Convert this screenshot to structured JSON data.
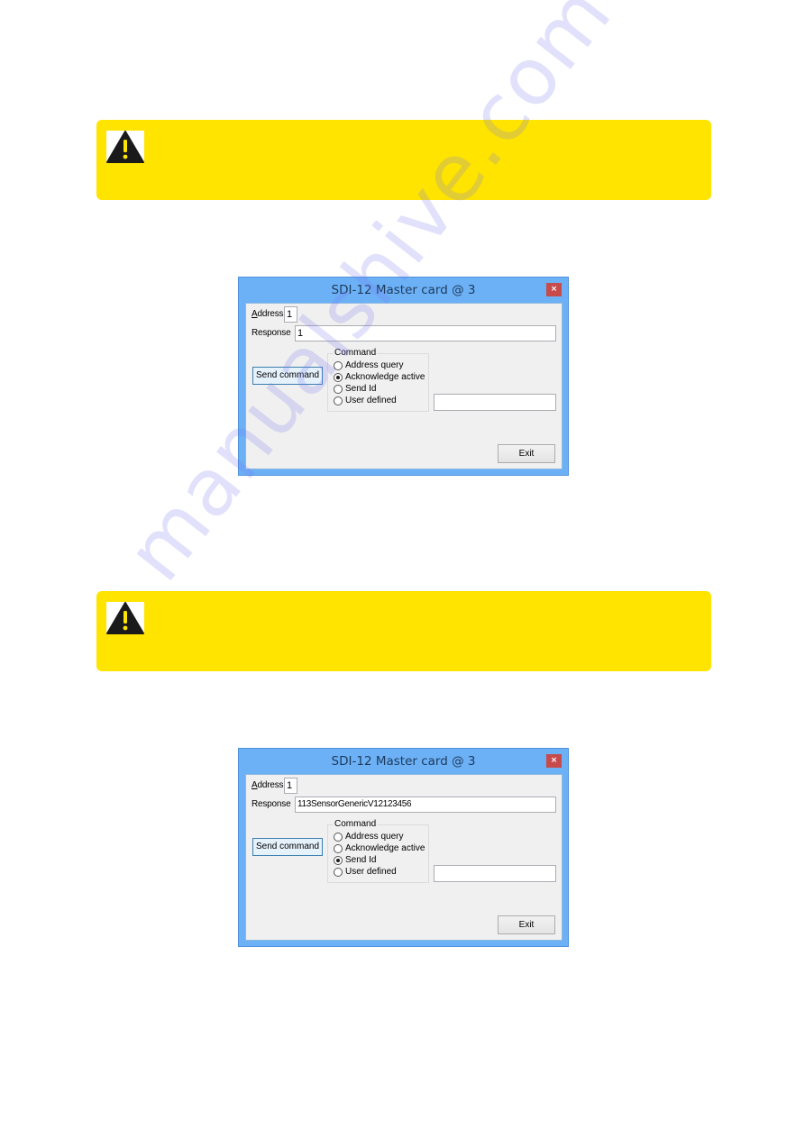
{
  "colors": {
    "warning_background": "#FFE400",
    "window_frame": "#6CB1F6",
    "close_button": "#C74B4B"
  },
  "warnings": [
    {
      "icon": "warning-triangle-icon",
      "text": ""
    },
    {
      "icon": "warning-triangle-icon",
      "text": ""
    }
  ],
  "dialogs": [
    {
      "title": "SDI-12 Master card @ 3",
      "close_glyph": "×",
      "address_label": "Address",
      "address_value": "1",
      "response_label": "Response",
      "response_value": "1",
      "send_button": "Send command",
      "command_group_label": "Command",
      "commands": [
        {
          "label": "Address query",
          "selected": false
        },
        {
          "label": "Acknowledge active",
          "selected": true
        },
        {
          "label": "Send Id",
          "selected": false
        },
        {
          "label": "User defined",
          "selected": false
        }
      ],
      "user_defined_value": "",
      "exit_button": "Exit"
    },
    {
      "title": "SDI-12 Master card @ 3",
      "close_glyph": "×",
      "address_label": "Address",
      "address_value": "1",
      "response_label": "Response",
      "response_value": "113SensorGenericV12123456",
      "send_button": "Send command",
      "command_group_label": "Command",
      "commands": [
        {
          "label": "Address query",
          "selected": false
        },
        {
          "label": "Acknowledge active",
          "selected": false
        },
        {
          "label": "Send Id",
          "selected": true
        },
        {
          "label": "User defined",
          "selected": false
        }
      ],
      "user_defined_value": "",
      "exit_button": "Exit"
    }
  ],
  "watermark": "manualshive.com"
}
